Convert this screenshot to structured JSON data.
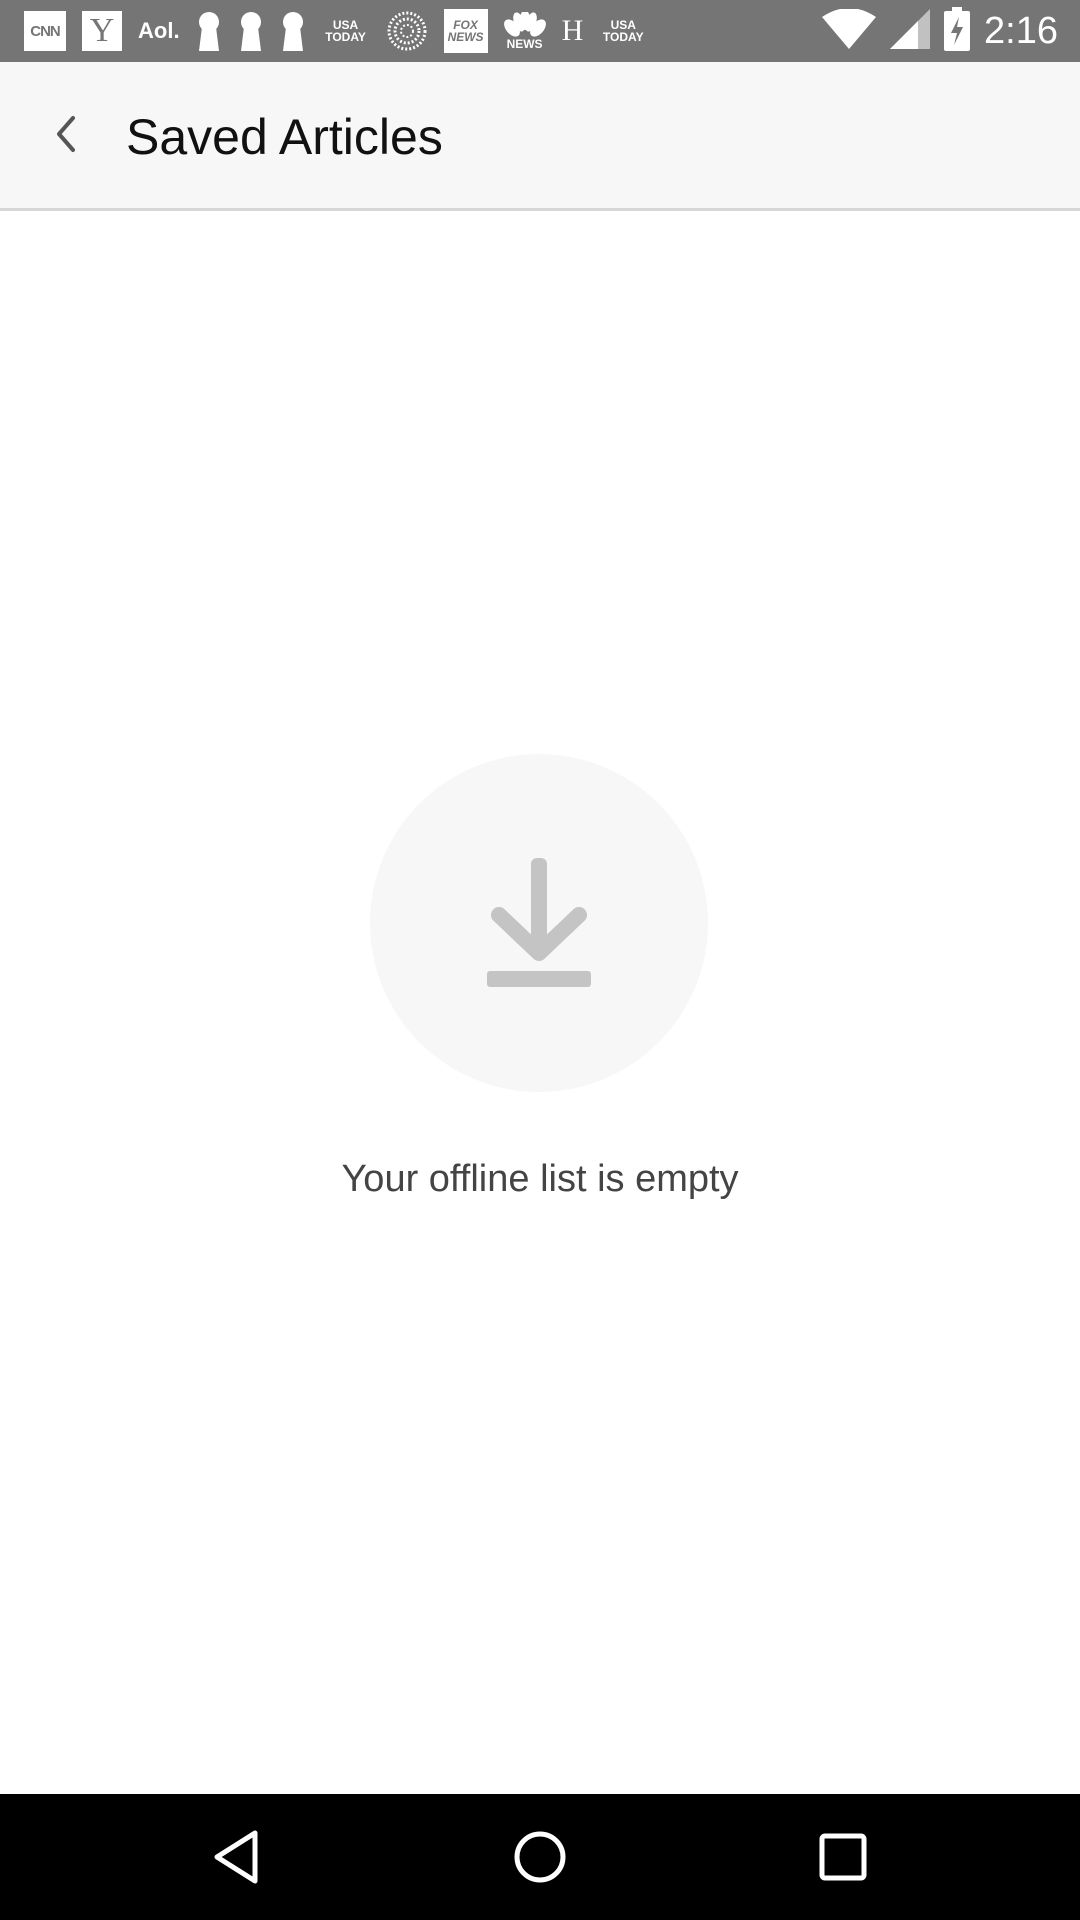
{
  "status_bar": {
    "time": "2:16",
    "notification_icons": [
      {
        "name": "cnn-icon",
        "label": "CNN"
      },
      {
        "name": "yahoo-icon",
        "label": "Y"
      },
      {
        "name": "aol-icon",
        "label": "Aol."
      },
      {
        "name": "keyhole-icon-1",
        "label": ""
      },
      {
        "name": "keyhole-icon-2",
        "label": ""
      },
      {
        "name": "keyhole-icon-3",
        "label": ""
      },
      {
        "name": "usa-today-icon-1",
        "label_top": "USA",
        "label_bottom": "TODAY"
      },
      {
        "name": "dotted-circle-icon",
        "label": ""
      },
      {
        "name": "fox-news-icon",
        "label_top": "FOX",
        "label_bottom": "NEWS"
      },
      {
        "name": "nbc-news-icon",
        "label": "NEWS"
      },
      {
        "name": "h-icon",
        "label": "H"
      },
      {
        "name": "usa-today-icon-2",
        "label_top": "USA",
        "label_bottom": "TODAY"
      }
    ]
  },
  "app_bar": {
    "title": "Saved Articles"
  },
  "empty_state": {
    "icon": "download-icon",
    "message": "Your offline list is empty"
  },
  "nav_bar": {
    "buttons": [
      "back",
      "home",
      "recents"
    ]
  },
  "colors": {
    "status_bar": "#757575",
    "app_bar": "#f7f7f7",
    "icon_gray": "#c4c4c4",
    "nav_bar": "#000000"
  }
}
